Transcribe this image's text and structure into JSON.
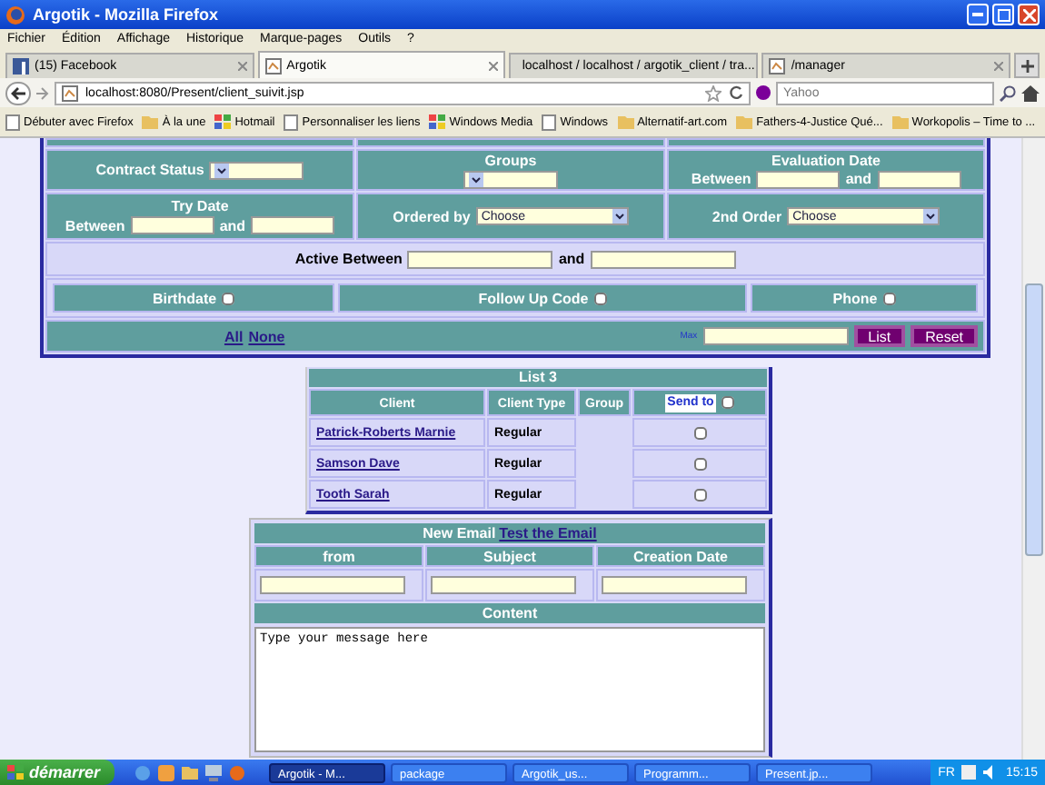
{
  "window": {
    "title": "Argotik - Mozilla Firefox"
  },
  "menu": [
    "Fichier",
    "Édition",
    "Affichage",
    "Historique",
    "Marque-pages",
    "Outils",
    "?"
  ],
  "tabs": [
    {
      "label": "(15) Facebook",
      "kind": "facebook",
      "selected": false
    },
    {
      "label": "Argotik",
      "kind": "page",
      "selected": true
    },
    {
      "label": "localhost / localhost / argotik_client / tra...",
      "kind": "db",
      "selected": false
    },
    {
      "label": "/manager",
      "kind": "page",
      "selected": false
    }
  ],
  "address": "localhost:8080/Present/client_suivit.jsp",
  "search": {
    "placeholder": "Yahoo"
  },
  "bookmarks": [
    {
      "label": "Débuter avec Firefox",
      "kind": "page"
    },
    {
      "label": "À la une",
      "kind": "folder"
    },
    {
      "label": "Hotmail",
      "kind": "windows"
    },
    {
      "label": "Personnaliser les liens",
      "kind": "page"
    },
    {
      "label": "Windows Media",
      "kind": "windows"
    },
    {
      "label": "Windows",
      "kind": "page"
    },
    {
      "label": "Alternatif-art.com",
      "kind": "folder"
    },
    {
      "label": "Fathers-4-Justice Qué...",
      "kind": "folder"
    },
    {
      "label": "Workopolis – Time to ...",
      "kind": "folder"
    }
  ],
  "form": {
    "contract_status": "Contract Status",
    "groups": "Groups",
    "evaluation_date": {
      "title": "Evaluation Date",
      "between": "Between",
      "and": "and"
    },
    "try_date": {
      "title": "Try Date",
      "between": "Between",
      "and": "and"
    },
    "ordered_by": {
      "label": "Ordered by",
      "value": "Choose"
    },
    "second_order": {
      "label": "2nd Order",
      "value": "Choose"
    },
    "active_between": {
      "label": "Active Between",
      "and": "and"
    },
    "columns": [
      {
        "label": "Birthdate",
        "checked": false
      },
      {
        "label": "Follow Up Code",
        "checked": false
      },
      {
        "label": "Phone",
        "checked": false
      }
    ],
    "links": [
      "All",
      "None"
    ],
    "max": "Max",
    "buttons": [
      "List",
      "Reset"
    ]
  },
  "list": {
    "title": "List 3",
    "columns": [
      "Client",
      "Client Type",
      "Group",
      "Send to"
    ],
    "send_all_checked": false,
    "rows": [
      {
        "client": "Patrick-Roberts Marnie",
        "client_type": "Regular",
        "send": false
      },
      {
        "client": "Samson Dave",
        "client_type": "Regular",
        "send": false
      },
      {
        "client": "Tooth Sarah",
        "client_type": "Regular",
        "send": false
      }
    ]
  },
  "email": {
    "title": "New Email",
    "link": "Test the Email",
    "columns": [
      "from",
      "Subject",
      "Creation Date"
    ],
    "content_label": "Content",
    "content": "Type your message here"
  },
  "taskbar": {
    "start": "démarrer",
    "tasks": [
      {
        "label": "Argotik - M...",
        "selected": true
      },
      {
        "label": "package",
        "selected": false
      },
      {
        "label": "Argotik_us...",
        "selected": false
      },
      {
        "label": "Programm...",
        "selected": false
      },
      {
        "label": "Present.jp...",
        "selected": false
      }
    ],
    "lang": "FR",
    "clock": "15:15"
  }
}
